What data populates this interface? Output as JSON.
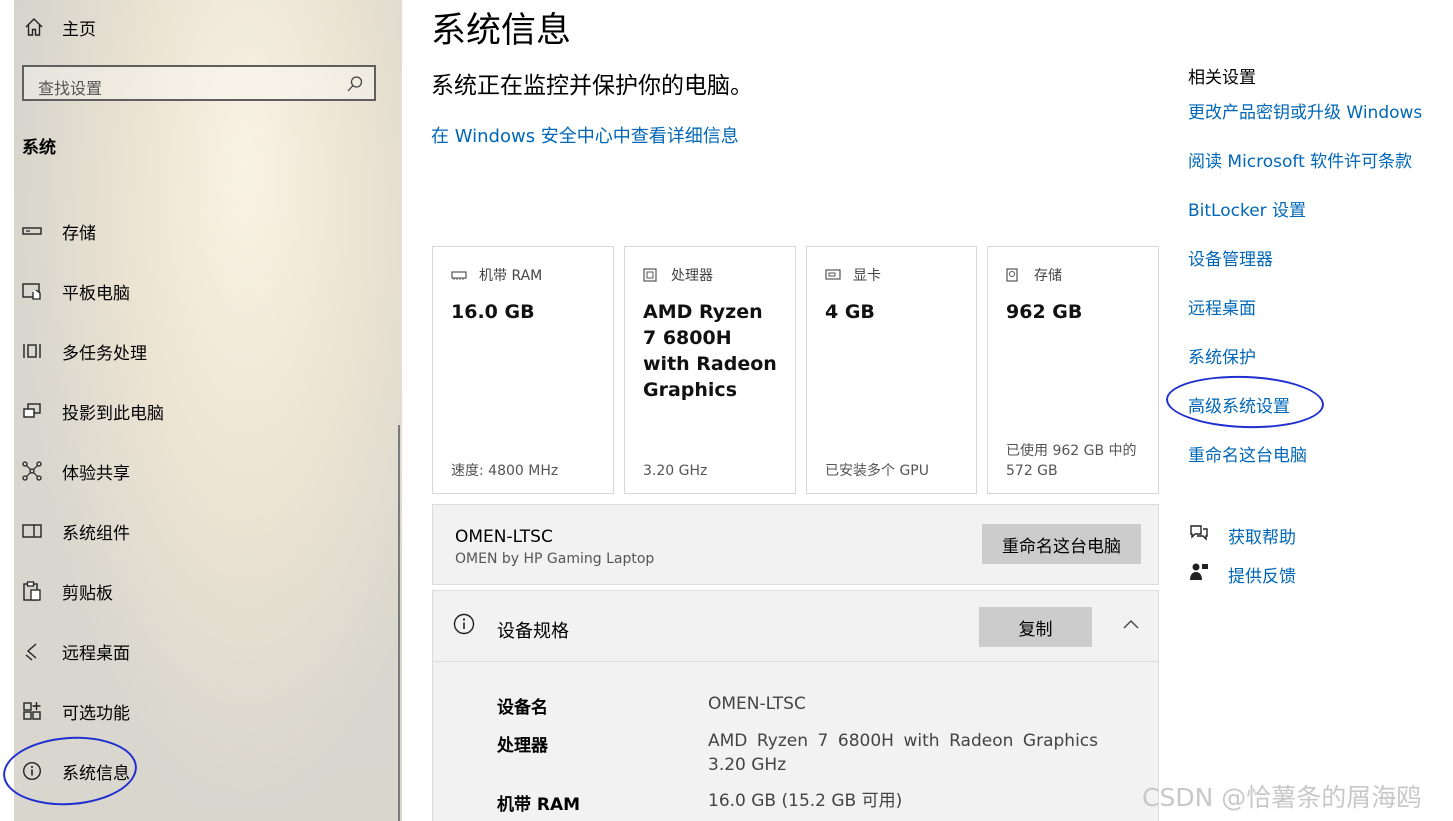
{
  "sidebar": {
    "home": "主页",
    "search_placeholder": "查找设置",
    "section": "系统",
    "items": [
      {
        "label": "存储"
      },
      {
        "label": "平板电脑"
      },
      {
        "label": "多任务处理"
      },
      {
        "label": "投影到此电脑"
      },
      {
        "label": "体验共享"
      },
      {
        "label": "系统组件"
      },
      {
        "label": "剪贴板"
      },
      {
        "label": "远程桌面"
      },
      {
        "label": "可选功能"
      },
      {
        "label": "系统信息"
      }
    ]
  },
  "main": {
    "title": "系统信息",
    "subtitle": "系统正在监控并保护你的电脑。",
    "security_link": "在 Windows 安全中心中查看详细信息",
    "cards": [
      {
        "label": "机带 RAM",
        "value": "16.0 GB",
        "footer": "速度: 4800 MHz"
      },
      {
        "label": "处理器",
        "value": "AMD Ryzen 7 6800H with Radeon Graphics",
        "footer": "3.20 GHz"
      },
      {
        "label": "显卡",
        "value": "4 GB",
        "footer": "已安装多个 GPU"
      },
      {
        "label": "存储",
        "value": "962 GB",
        "footer": "已使用 962 GB 中的 572 GB"
      }
    ],
    "device": {
      "name": "OMEN-LTSC",
      "model": "OMEN by HP Gaming Laptop",
      "rename_button": "重命名这台电脑"
    },
    "specs": {
      "title": "设备规格",
      "copy_button": "复制",
      "rows": [
        {
          "key": "设备名",
          "value": "OMEN-LTSC"
        },
        {
          "key": "处理器",
          "value": "AMD Ryzen 7 6800H with Radeon Graphics 3.20 GHz"
        },
        {
          "key": "机带 RAM",
          "value": "16.0 GB (15.2 GB 可用)"
        }
      ]
    }
  },
  "related": {
    "title": "相关设置",
    "links": [
      "更改产品密钥或升级 Windows",
      "阅读 Microsoft 软件许可条款",
      "BitLocker 设置",
      "设备管理器",
      "远程桌面",
      "系统保护",
      "高级系统设置",
      "重命名这台电脑"
    ],
    "help": "获取帮助",
    "feedback": "提供反馈"
  },
  "watermark": "CSDN @恰薯条的屑海鸥",
  "colors": {
    "link": "#0067b8",
    "annotation": "#1f2fd0",
    "button": "#cccccc"
  }
}
